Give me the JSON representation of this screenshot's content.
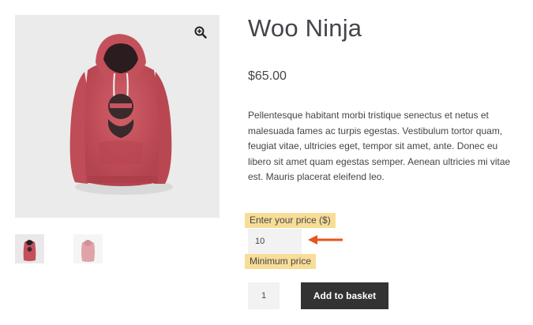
{
  "product": {
    "title": "Woo Ninja",
    "price": "$65.00",
    "description": "Pellentesque habitant morbi tristique senectus et netus et malesuada fames ac turpis egestas. Vestibulum tortor quam, feugiat vitae, ultricies eget, tempor sit amet, ante. Donec eu libero sit amet quam egestas semper. Aenean ultricies mi vitae est. Mauris placerat eleifend leo."
  },
  "name_your_price": {
    "label": "Enter your price ($)",
    "value": "10",
    "minimum_label": "Minimum price"
  },
  "cart": {
    "quantity": "1",
    "add_button_label": "Add to basket"
  },
  "gallery": {
    "zoom_icon": "magnifier-plus-icon",
    "thumbnails": [
      "hoodie-red-front",
      "hoodie-pink-back"
    ]
  },
  "colors": {
    "hoodie": "#c8545e",
    "highlight": "#f8dd96",
    "arrow": "#e8531e",
    "button": "#333333"
  }
}
